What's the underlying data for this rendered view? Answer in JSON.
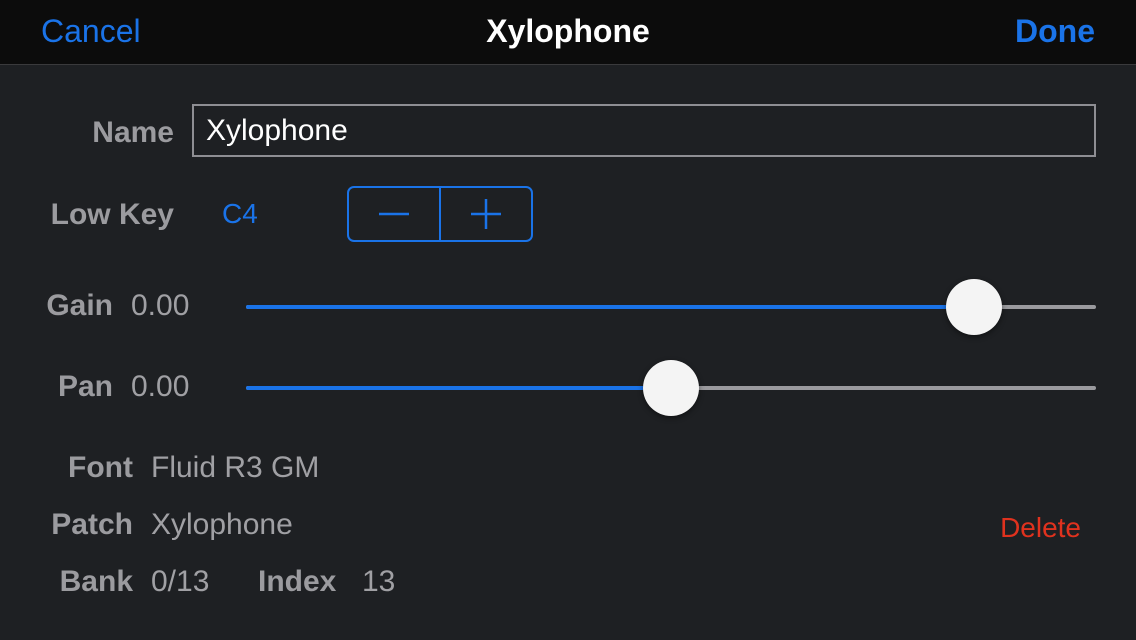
{
  "navbar": {
    "cancel_label": "Cancel",
    "title": "Xylophone",
    "done_label": "Done"
  },
  "form": {
    "name_label": "Name",
    "name_value": "Xylophone",
    "low_key_label": "Low Key",
    "low_key_value": "C4",
    "gain_label": "Gain",
    "gain_value": "0.00",
    "gain_slider_fraction": 0.856,
    "pan_label": "Pan",
    "pan_value": "0.00",
    "pan_slider_fraction": 0.5,
    "font_label": "Font",
    "font_value": "Fluid R3 GM",
    "patch_label": "Patch",
    "patch_value": "Xylophone",
    "bank_label": "Bank",
    "bank_value": "0/13",
    "index_label": "Index",
    "index_value": "13",
    "delete_label": "Delete"
  },
  "icons": {
    "decrement": "minus-icon",
    "increment": "plus-icon"
  },
  "colors": {
    "accent": "#1a73e8",
    "destructive": "#e0321e",
    "background": "#1e2023",
    "navbar": "#0c0c0c"
  }
}
